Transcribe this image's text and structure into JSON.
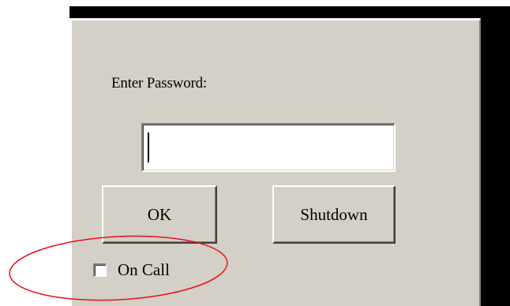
{
  "dialog": {
    "prompt_label": "Enter Password:",
    "password_value": "",
    "ok_label": "OK",
    "shutdown_label": "Shutdown",
    "checkbox_label": "On Call",
    "checkbox_checked": false
  },
  "annotation": {
    "shape": "ellipse",
    "color": "#e8101a"
  },
  "colors": {
    "dialog_face": "#d4d0c8",
    "backdrop": "#000000"
  }
}
